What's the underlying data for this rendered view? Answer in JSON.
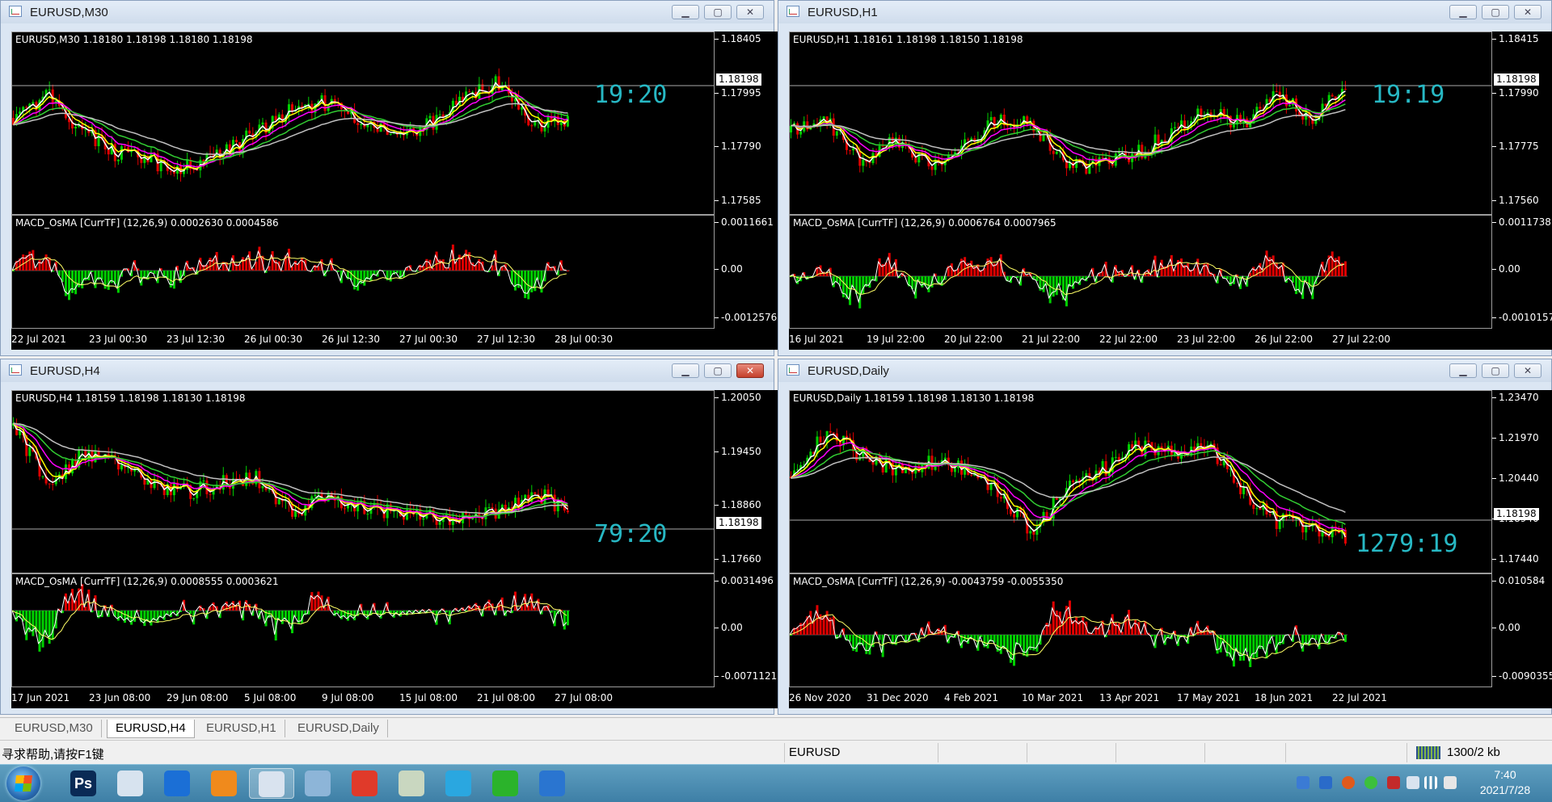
{
  "windows": [
    {
      "title": "EURUSD,M30",
      "price_label": "EURUSD,M30  1.18180 1.18198 1.18180 1.18198",
      "macd_label": "MACD_OsMA [CurrTF] (12,26,9) 0.0002630 0.0004586",
      "yticks": [
        "1.18405",
        "1.17995",
        "1.17790",
        "1.17585"
      ],
      "current_price": "1.18198",
      "macd_yticks": [
        "0.0011661",
        "0.00",
        "-0.0012576"
      ],
      "xticks": [
        "22 Jul 2021",
        "23 Jul 00:30",
        "23 Jul 12:30",
        "26 Jul 00:30",
        "26 Jul 12:30",
        "27 Jul 00:30",
        "27 Jul 12:30",
        "28 Jul 00:30"
      ],
      "timer": "19:20"
    },
    {
      "title": "EURUSD,H1",
      "price_label": "EURUSD,H1  1.18161 1.18198 1.18150 1.18198",
      "macd_label": "MACD_OsMA [CurrTF] (12,26,9) 0.0006764 0.0007965",
      "yticks": [
        "1.18415",
        "1.17990",
        "1.17775",
        "1.17560"
      ],
      "current_price": "1.18198",
      "macd_yticks": [
        "0.0011738",
        "0.00",
        "-0.0010157"
      ],
      "xticks": [
        "16 Jul 2021",
        "19 Jul 22:00",
        "20 Jul 22:00",
        "21 Jul 22:00",
        "22 Jul 22:00",
        "23 Jul 22:00",
        "26 Jul 22:00",
        "27 Jul 22:00"
      ],
      "timer": "19:19"
    },
    {
      "title": "EURUSD,H4",
      "price_label": "EURUSD,H4  1.18159 1.18198 1.18130 1.18198",
      "macd_label": "MACD_OsMA [CurrTF] (12,26,9) 0.0008555 0.0003621",
      "yticks": [
        "1.20050",
        "1.19450",
        "1.18860",
        "1.17660"
      ],
      "current_price": "1.18198",
      "macd_yticks": [
        "0.0031496",
        "0.00",
        "-0.0071121"
      ],
      "xticks": [
        "17 Jun 2021",
        "23 Jun 08:00",
        "29 Jun 08:00",
        "5 Jul 08:00",
        "9 Jul 08:00",
        "15 Jul 08:00",
        "21 Jul 08:00",
        "27 Jul 08:00"
      ],
      "timer": "79:20"
    },
    {
      "title": "EURUSD,Daily",
      "price_label": "EURUSD,Daily  1.18159 1.18198 1.18130 1.18198",
      "macd_label": "MACD_OsMA [CurrTF] (12,26,9) -0.0043759 -0.0055350",
      "yticks": [
        "1.23470",
        "1.21970",
        "1.20440",
        "1.18940",
        "1.17440"
      ],
      "current_price": "1.18198",
      "macd_yticks": [
        "0.010584",
        "0.00",
        "-0.0090355"
      ],
      "xticks": [
        "26 Nov 2020",
        "31 Dec 2020",
        "4 Feb 2021",
        "10 Mar 2021",
        "13 Apr 2021",
        "17 May 2021",
        "18 Jun 2021",
        "22 Jul 2021"
      ],
      "timer": "1279:19"
    }
  ],
  "window_buttons": {
    "minimize": "▁",
    "maximize": "▢",
    "close": "✕"
  },
  "tabs": [
    {
      "label": "EURUSD,M30",
      "active": false
    },
    {
      "label": "EURUSD,H4",
      "active": true
    },
    {
      "label": "EURUSD,H1",
      "active": false
    },
    {
      "label": "EURUSD,Daily",
      "active": false
    }
  ],
  "status": {
    "help": "寻求帮助,请按F1键",
    "symbol": "EURUSD",
    "traffic": "1300/2 kb"
  },
  "taskbar": {
    "apps": [
      {
        "icon": "photoshop-icon",
        "text": "Ps",
        "color": "#0a2a55"
      },
      {
        "icon": "document-app-icon",
        "text": "",
        "color": "#d7e3ef"
      },
      {
        "icon": "lanxin-icon",
        "text": "",
        "color": "#1b6fd6"
      },
      {
        "icon": "fox-app-icon",
        "text": "",
        "color": "#f08a1c"
      },
      {
        "icon": "metatrader-icon",
        "text": "",
        "color": "#d9e3ef"
      },
      {
        "icon": "notes-app-icon",
        "text": "",
        "color": "#8db5d8"
      },
      {
        "icon": "wps-icon",
        "text": "",
        "color": "#e03a2a"
      },
      {
        "icon": "paint-app-icon",
        "text": "",
        "color": "#c9d7c0"
      },
      {
        "icon": "media-player-icon",
        "text": "",
        "color": "#2aa7e0"
      },
      {
        "icon": "wechat-icon",
        "text": "",
        "color": "#2bb32b"
      },
      {
        "icon": "security-shield-icon",
        "text": "",
        "color": "#2a75d0"
      }
    ],
    "clock_time": "7:40",
    "clock_date": "2021/7/28"
  },
  "colors": {
    "bull": "#00d000",
    "bear": "#e00000",
    "ema_fast": "#ffffff",
    "ema_mid": "#ffff00",
    "ema_slow": "#ff00ff",
    "ema_long": "#32cd32",
    "sma": "#c0c0c0",
    "timer": "#27b8c4"
  }
}
